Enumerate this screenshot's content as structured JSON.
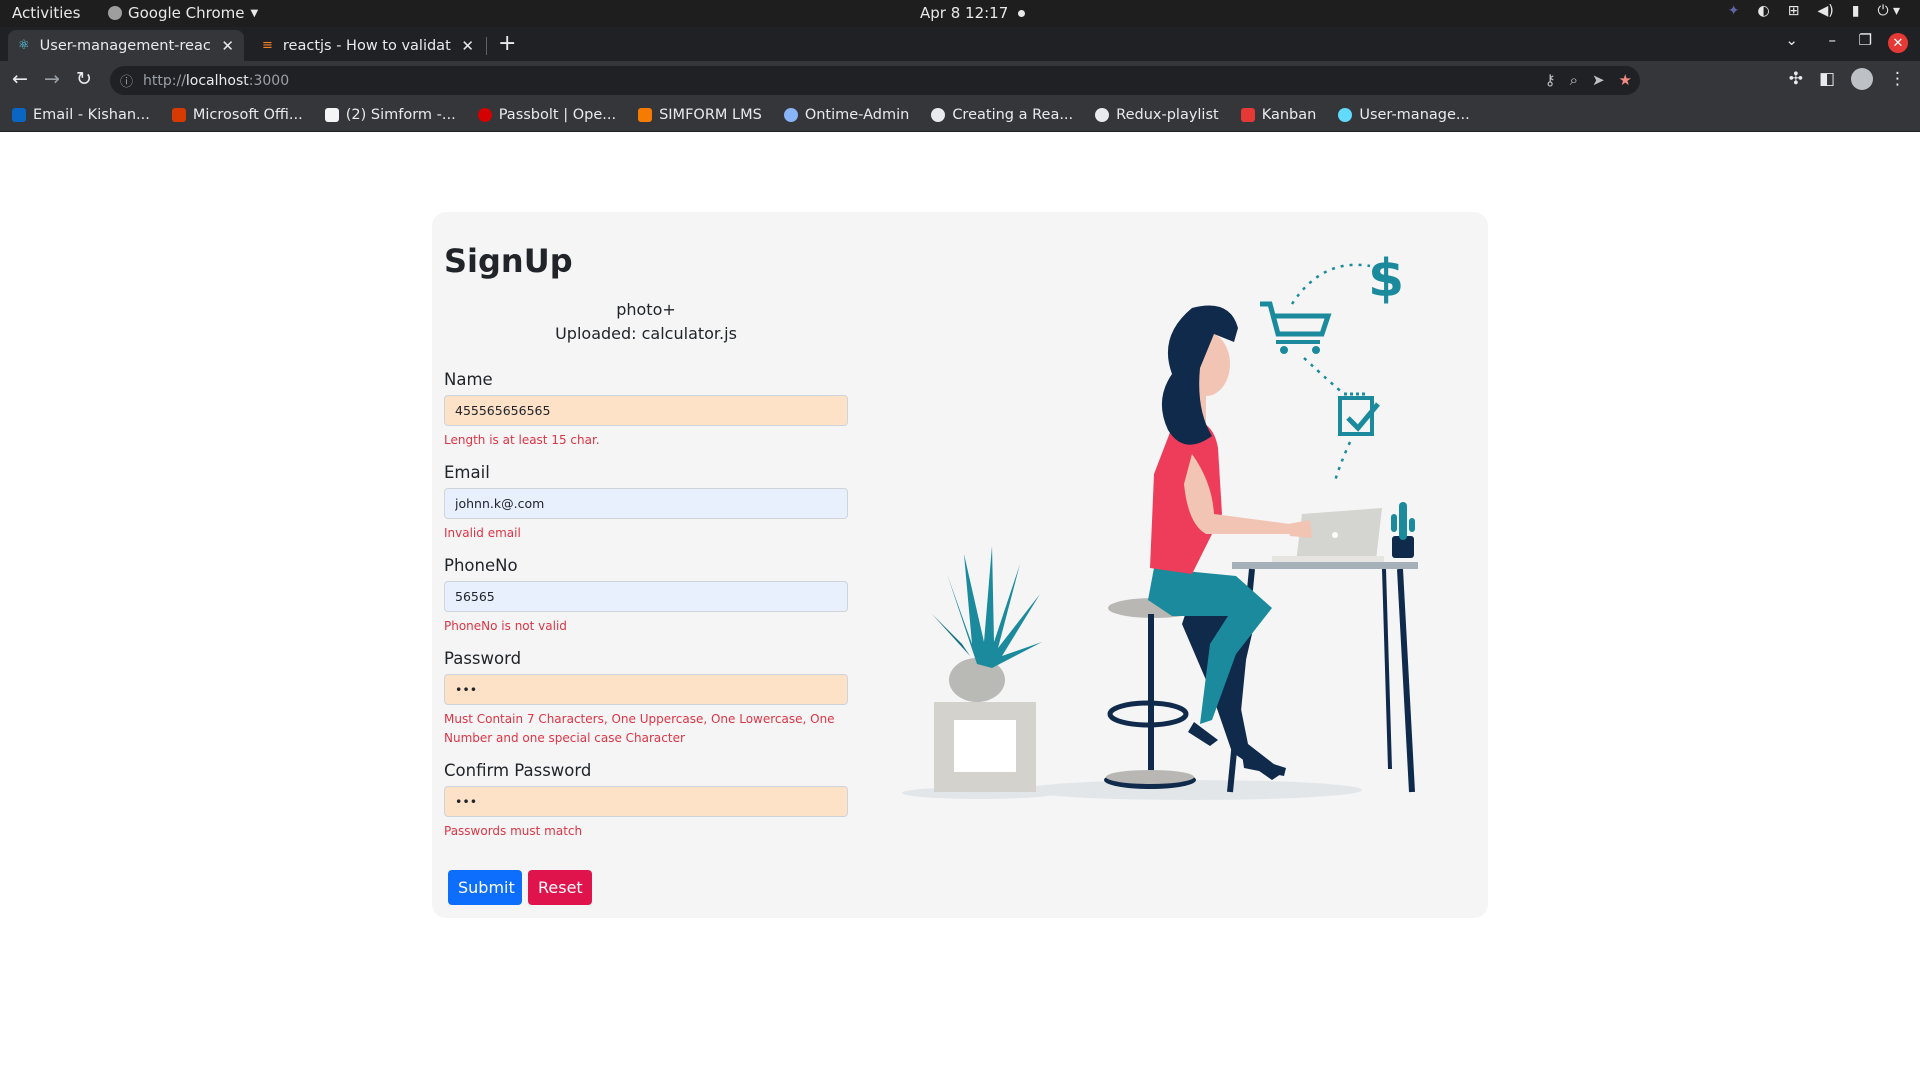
{
  "system_bar": {
    "activities": "Activities",
    "app_name": "Google Chrome",
    "clock": "Apr 8  12:17"
  },
  "tabs": [
    {
      "title": "User-management-react-a"
    },
    {
      "title": "reactjs - How to validate e"
    }
  ],
  "address_bar": {
    "scheme": "http://",
    "host": "localhost",
    "port": ":3000"
  },
  "bookmarks": [
    {
      "label": "Email - Kishan...",
      "color": "#0a66c2"
    },
    {
      "label": "Microsoft Offi...",
      "color": "#d83b01"
    },
    {
      "label": "(2) Simform -...",
      "color": "#f5f5f5"
    },
    {
      "label": "Passbolt | Ope...",
      "color": "#d40101"
    },
    {
      "label": "SIMFORM LMS",
      "color": "#f57c00"
    },
    {
      "label": "Ontime-Admin",
      "color": "#8ab4f8"
    },
    {
      "label": "Creating a Rea...",
      "color": "#e8eaed"
    },
    {
      "label": "Redux-playlist",
      "color": "#e8eaed"
    },
    {
      "label": "Kanban",
      "color": "#e53935"
    },
    {
      "label": "User-manage...",
      "color": "#61dafb"
    }
  ],
  "form": {
    "title": "SignUp",
    "photo_label": "photo+",
    "uploaded_text": "Uploaded: calculator.js",
    "name": {
      "label": "Name",
      "value": "455565656565",
      "error": "Length is at least 15 char."
    },
    "email": {
      "label": "Email",
      "value": "johnn.k@.com",
      "error": "Invalid email"
    },
    "phone": {
      "label": "PhoneNo",
      "value": "56565",
      "error": "PhoneNo is not valid"
    },
    "password": {
      "label": "Password",
      "value": "•••",
      "error": "Must Contain 7 Characters, One Uppercase, One Lowercase, One Number and one special case Character"
    },
    "confirm": {
      "label": "Confirm Password",
      "value": "•••",
      "error": "Passwords must match"
    },
    "submit_label": "Submit",
    "reset_label": "Reset"
  },
  "colors": {
    "submit": "#0d6efd",
    "reset": "#e0144c",
    "error": "#dc3545",
    "illustration_teal": "#1a8a9c",
    "illustration_navy": "#0f2a4a",
    "illustration_red": "#ee3d5a"
  }
}
